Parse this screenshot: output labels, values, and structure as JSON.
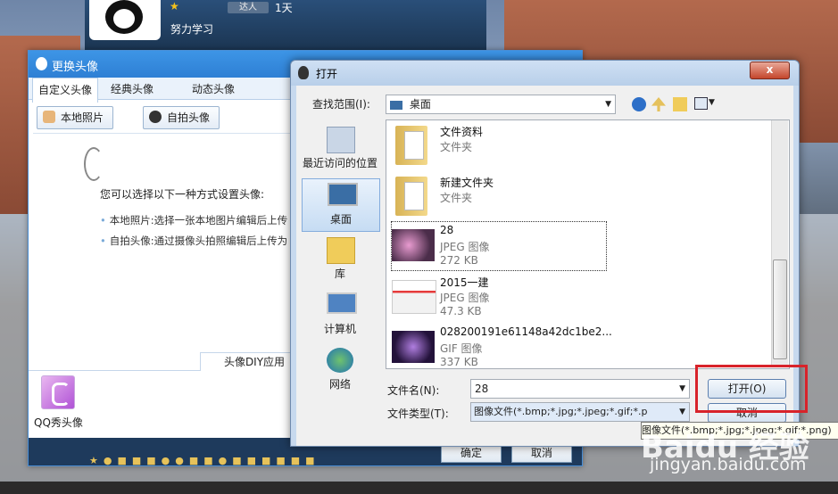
{
  "qq_profile": {
    "mood": "努力学习",
    "badge": "达人",
    "days": "1天"
  },
  "avatar_window": {
    "title": "更换头像",
    "tabs": [
      "自定义头像",
      "经典头像",
      "动态头像"
    ],
    "buttons": [
      "本地照片",
      "自拍头像"
    ],
    "hint": "您可以选择以下一种方式设置头像:",
    "bullets": [
      "本地照片:选择一张本地图片编辑后上传",
      "自拍头像:通过摄像头拍照编辑后上传为"
    ],
    "diy_tab": "头像DIY应用",
    "qqshow_label": "QQ秀头像",
    "ok_label": "确定",
    "cancel_label": "取消"
  },
  "open_dialog": {
    "title": "打开",
    "close_symbol": "x",
    "lookin_label": "查找范围(I):",
    "lookin_value": "桌面",
    "places": [
      "最近访问的位置",
      "桌面",
      "库",
      "计算机",
      "网络"
    ],
    "files": [
      {
        "name": "文件资料",
        "type": "文件夹",
        "size": ""
      },
      {
        "name": "新建文件夹",
        "type": "文件夹",
        "size": ""
      },
      {
        "name": "28",
        "type": "JPEG 图像",
        "size": "272 KB"
      },
      {
        "name": "2015一建",
        "type": "JPEG 图像",
        "size": "47.3 KB"
      },
      {
        "name": "028200191e61148a42dc1be2...",
        "type": "GIF 图像",
        "size": "337 KB"
      }
    ],
    "filename_label": "文件名(N):",
    "filename_value": "28",
    "filetype_label": "文件类型(T):",
    "filetype_value": "图像文件(*.bmp;*.jpg;*.jpeg;*.gif;*.p",
    "open_label": "打开(O)",
    "cancel_label": "取消",
    "tooltip": "图像文件(*.bmp;*.jpg;*.jpeg;*.gif;*.png)"
  },
  "watermark": {
    "brand": "Baidu 经验",
    "url": "jingyan.baidu.com"
  },
  "colors": {
    "highlight": "#d8232a",
    "accent": "#2e7fd4"
  }
}
